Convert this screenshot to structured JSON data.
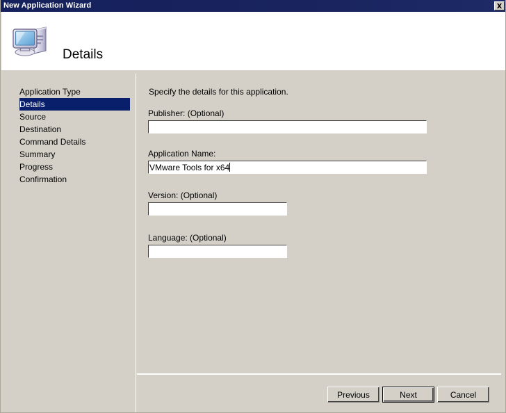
{
  "window": {
    "title": "New Application Wizard",
    "close_label": "Close",
    "close_icon": "close-icon"
  },
  "header": {
    "icon": "computer-icon",
    "title": "Details"
  },
  "sidebar": {
    "items": [
      {
        "label": "Application Type",
        "selected": false
      },
      {
        "label": "Details",
        "selected": true
      },
      {
        "label": "Source",
        "selected": false
      },
      {
        "label": "Destination",
        "selected": false
      },
      {
        "label": "Command Details",
        "selected": false
      },
      {
        "label": "Summary",
        "selected": false
      },
      {
        "label": "Progress",
        "selected": false
      },
      {
        "label": "Confirmation",
        "selected": false
      }
    ]
  },
  "main": {
    "intro": "Specify the details for this application.",
    "fields": [
      {
        "label": "Publisher: (Optional)",
        "value": "",
        "placeholder": "",
        "width": "wide",
        "focused": false,
        "name": "publisher"
      },
      {
        "label": "Application Name:",
        "value": "VMware Tools for x64",
        "placeholder": "",
        "width": "wide",
        "focused": true,
        "name": "application-name"
      },
      {
        "label": "Version: (Optional)",
        "value": "",
        "placeholder": "",
        "width": "short",
        "focused": false,
        "name": "version"
      },
      {
        "label": "Language: (Optional)",
        "value": "",
        "placeholder": "",
        "width": "short",
        "focused": false,
        "name": "language"
      }
    ]
  },
  "buttons": {
    "previous": "Previous",
    "next": "Next",
    "cancel": "Cancel"
  },
  "colors": {
    "titlebar": "#15215c",
    "face": "#d4d0c8",
    "selection": "#0a1f6b",
    "field_bg": "#ffffff"
  }
}
